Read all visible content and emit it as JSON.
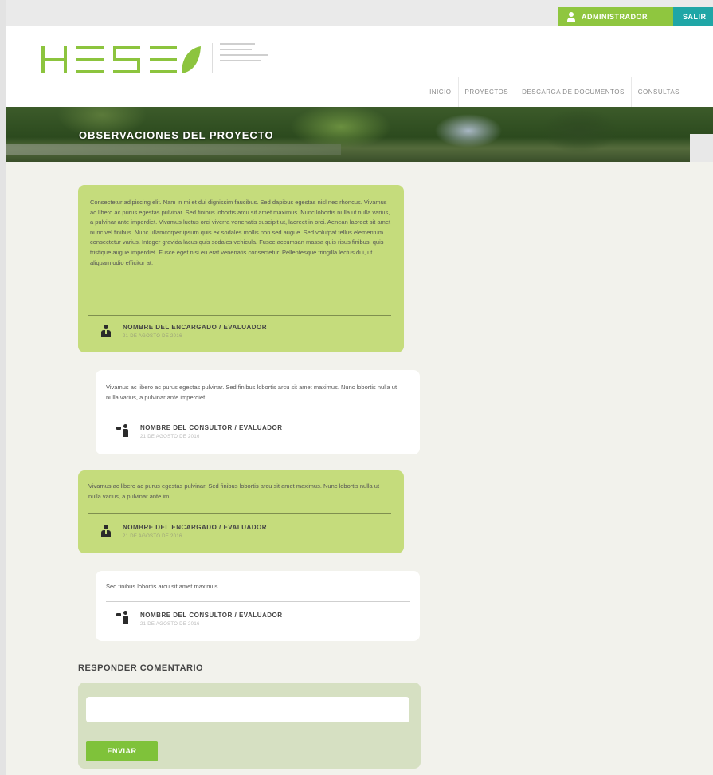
{
  "topbar": {
    "admin_label": "ADMINISTRADOR",
    "logout_label": "SALIR",
    "colors": {
      "admin": "#8fc63f",
      "logout": "#1fa6a6"
    }
  },
  "header": {
    "logo_text": "HESE",
    "nav": [
      {
        "label": "INICIO"
      },
      {
        "label": "PROYECTOS"
      },
      {
        "label": "DESCARGA DE DOCUMENTOS"
      },
      {
        "label": "CONSULTAS"
      }
    ]
  },
  "banner": {
    "title": "OBSERVACIONES DEL PROYECTO"
  },
  "comments": [
    {
      "text": "Consectetur adipiscing elit. Nam in mi et dui dignissim faucibus. Sed dapibus egestas nisl nec rhoncus. Vivamus ac libero ac purus egestas pulvinar. Sed finibus lobortis arcu sit amet maximus. Nunc lobortis nulla ut nulla varius, a pulvinar ante imperdiet. Vivamus luctus orci viverra venenatis suscipit ut, laoreet in orci. Aenean laoreet sit amet nunc vel finibus. Nunc ullamcorper ipsum quis ex sodales mollis non sed augue. Sed volutpat tellus elementum consectetur varius. Integer gravida lacus quis sodales vehicula. Fusce accumsan massa quis risus finibus, quis tristique augue imperdiet. Fusce eget nisi eu erat venenatis consectetur. Pellentesque fringilla lectus dui, ut aliquam odio efficitur at.",
      "author": "NOMBRE DEL ENCARGADO / EVALUADOR",
      "date": "21 DE AGOSTO DE 2016"
    },
    {
      "text": "Vivamus ac libero ac purus egestas pulvinar. Sed finibus lobortis arcu sit amet maximus. Nunc lobortis nulla ut nulla varius, a pulvinar ante imperdiet.",
      "author": "NOMBRE DEL CONSULTOR / EVALUADOR",
      "date": "21 DE AGOSTO DE 2016"
    },
    {
      "text": "Vivamus ac libero ac purus egestas pulvinar. Sed finibus lobortis arcu sit amet maximus. Nunc lobortis nulla ut nulla varius, a pulvinar ante im...",
      "author": "NOMBRE DEL ENCARGADO / EVALUADOR",
      "date": "21 DE AGOSTO DE 2016"
    },
    {
      "text": "Sed finibus lobortis arcu sit amet maximus.",
      "author": "NOMBRE DEL CONSULTOR / EVALUADOR",
      "date": "21 DE AGOSTO DE 2016"
    }
  ],
  "reply": {
    "title": "RESPONDER COMENTARIO",
    "input_value": "",
    "submit_label": "ENVIAR"
  }
}
